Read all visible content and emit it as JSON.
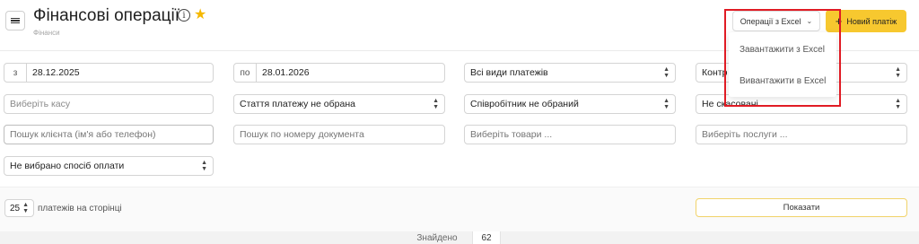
{
  "header": {
    "title": "Фінансові операції",
    "breadcrumb": "Фінанси",
    "info_icon": "info-icon",
    "star_icon": "star-icon"
  },
  "toolbar": {
    "excel_ops_label": "Операції з Excel",
    "new_payment_label": "Новий платіж",
    "accent_color": "#f7c82f"
  },
  "excel_menu": {
    "items": [
      "Завантажити з Excel",
      "Вивантажити в Excel"
    ]
  },
  "filters": {
    "date_from_prefix": "з",
    "date_from": "28.12.2025",
    "date_to_prefix": "по",
    "date_to": "28.01.2026",
    "payment_types": "Всі види платежів",
    "counterparty": "Контр",
    "cashbox_placeholder": "Виберіть касу",
    "article": "Стаття платежу не обрана",
    "employee": "Співробітник не обраний",
    "cancel_status": "Не скасовані",
    "client_placeholder": "Пошук клієнта (ім'я або телефон)",
    "document_placeholder": "Пошук по номеру документа",
    "goods_placeholder": "Виберіть товари ...",
    "services_placeholder": "Виберіть послуги ...",
    "payment_method": "Не вибрано спосіб оплати"
  },
  "pagination": {
    "per_page": "25",
    "per_page_label": "платежів на сторінці",
    "show_label": "Показати"
  },
  "results": {
    "found_label": "Знайдено",
    "found_count": "62"
  }
}
